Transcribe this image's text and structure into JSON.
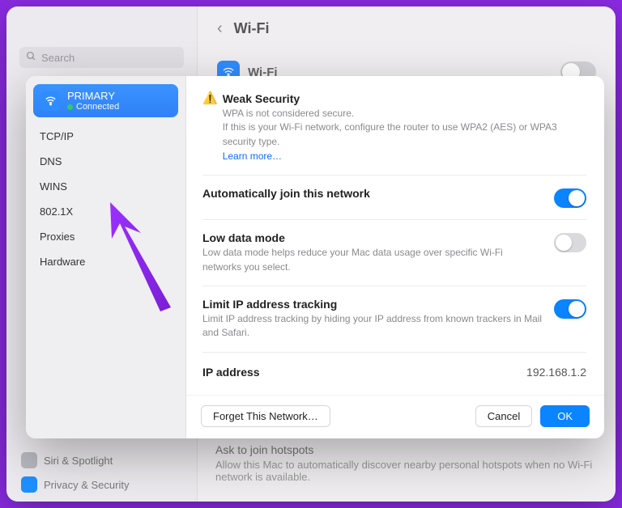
{
  "bg": {
    "search_placeholder": "Search",
    "title": "Wi-Fi",
    "wifi_label": "Wi-Fi",
    "ask_title": "Ask to join hotspots",
    "ask_desc": "Allow this Mac to automatically discover nearby personal hotspots when no Wi-Fi network is available.",
    "sb_siri": "Siri & Spotlight",
    "sb_privacy": "Privacy & Security"
  },
  "sheet": {
    "primary": {
      "name": "PRIMARY",
      "status": "Connected"
    },
    "tabs": [
      "TCP/IP",
      "DNS",
      "WINS",
      "802.1X",
      "Proxies",
      "Hardware"
    ],
    "security": {
      "title": "Weak Security",
      "line1": "WPA is not considered secure.",
      "line2": "If this is your Wi-Fi network, configure the router to use WPA2 (AES) or WPA3 security type.",
      "link": "Learn more…"
    },
    "autojoin": {
      "title": "Automatically join this network"
    },
    "lowdata": {
      "title": "Low data mode",
      "desc": "Low data mode helps reduce your Mac data usage over specific Wi-Fi networks you select."
    },
    "limitip": {
      "title": "Limit IP address tracking",
      "desc": "Limit IP address tracking by hiding your IP address from known trackers in Mail and Safari."
    },
    "ip": {
      "label": "IP address",
      "value": "192.168.1.2"
    },
    "buttons": {
      "forget": "Forget This Network…",
      "cancel": "Cancel",
      "ok": "OK"
    }
  }
}
